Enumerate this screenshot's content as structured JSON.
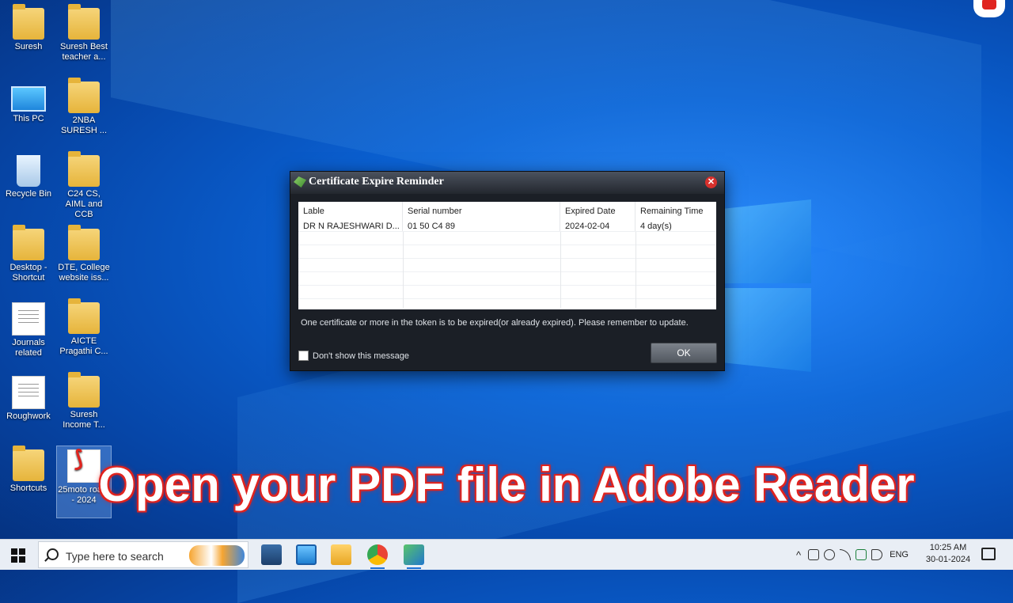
{
  "desktop": {
    "icons": [
      {
        "label": "Suresh",
        "kind": "folder"
      },
      {
        "label": "Suresh Best teacher a...",
        "kind": "folder"
      },
      {
        "label": "This PC",
        "kind": "pc"
      },
      {
        "label": "2NBA SURESH ...",
        "kind": "folder"
      },
      {
        "label": "Recycle Bin",
        "kind": "bin"
      },
      {
        "label": "C24 CS, AIML and CCB",
        "kind": "folder"
      },
      {
        "label": "Desktop - Shortcut",
        "kind": "folder"
      },
      {
        "label": "DTE, College website iss...",
        "kind": "folder"
      },
      {
        "label": "Journals related",
        "kind": "doc"
      },
      {
        "label": "AICTE Pragathi C...",
        "kind": "folder"
      },
      {
        "label": "Roughwork",
        "kind": "doc"
      },
      {
        "label": "Suresh Income T...",
        "kind": "folder"
      },
      {
        "label": "Shortcuts",
        "kind": "folder"
      },
      {
        "label": "25moto road-- 2024",
        "kind": "pdf"
      }
    ]
  },
  "dialog": {
    "title": "Certificate Expire Reminder",
    "columns": [
      "Lable",
      "Serial number",
      "Expired Date",
      "Remaining Time"
    ],
    "rows": [
      [
        "DR N RAJESHWARI D...",
        "01 50 C4 89",
        "2024-02-04",
        "4 day(s)"
      ]
    ],
    "message": "One certificate or more in the token is to be expired(or already expired). Please remember to update.",
    "checkbox_label": "Don't show this message",
    "ok_label": "OK",
    "close_glyph": "✕"
  },
  "overlay": {
    "caption": "Open your PDF file in Adobe Reader"
  },
  "taskbar": {
    "search_placeholder": "Type here to search",
    "language": "ENG",
    "time": "10:25 AM",
    "date": "30-01-2024",
    "tray_chevron": "^"
  }
}
